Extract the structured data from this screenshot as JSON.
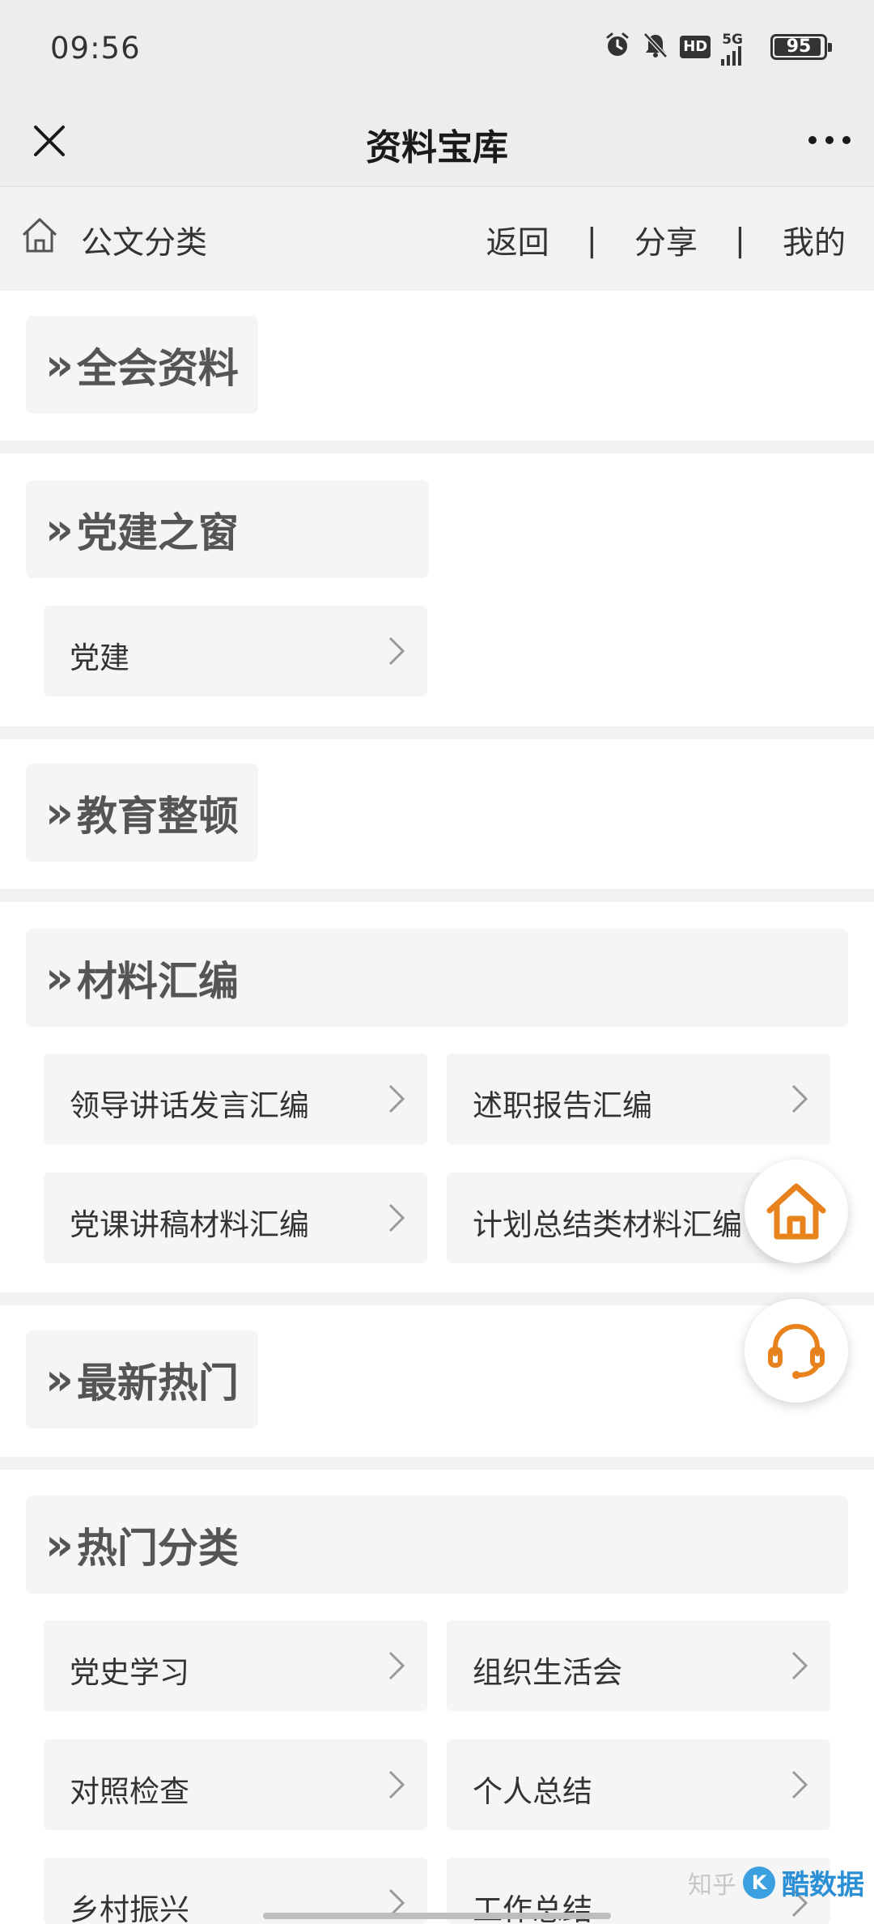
{
  "status_bar": {
    "time": "09:56",
    "network": "5G",
    "hd": "HD",
    "battery": "95",
    "battery_level": 0.95,
    "icons": [
      "alarm-icon",
      "mute-icon",
      "hd-icon",
      "signal-icon",
      "battery-icon"
    ]
  },
  "nav": {
    "title": "资料宝库",
    "close_icon": "close-icon",
    "more_icon": "more-icon"
  },
  "top_menu": {
    "home_label": "公文分类",
    "links": [
      "返回",
      "分享",
      "我的"
    ],
    "separator": "|"
  },
  "sections": [
    {
      "title": "全会资料",
      "items": []
    },
    {
      "title": "党建之窗",
      "items": [
        "党建"
      ]
    },
    {
      "title": "教育整顿",
      "items": []
    },
    {
      "title": "材料汇编",
      "items": [
        "领导讲话发言汇编",
        "述职报告汇编",
        "党课讲稿材料汇编",
        "计划总结类材料汇编"
      ]
    },
    {
      "title": "最新热门",
      "items": []
    },
    {
      "title": "热门分类",
      "items": [
        "党史学习",
        "组织生活会",
        "对照检查",
        "个人总结",
        "乡村振兴",
        "工作总结"
      ]
    }
  ],
  "section_marker": "»",
  "floating": {
    "home_icon": "home-icon",
    "support_icon": "headset-icon"
  },
  "watermark": {
    "zhihu": "知乎",
    "brand": "酷数据"
  },
  "colors": {
    "accent": "#e8821c",
    "background": "#ffffff",
    "section_bg": "#f5f5f5",
    "gap_bg": "#f2f2f2"
  }
}
